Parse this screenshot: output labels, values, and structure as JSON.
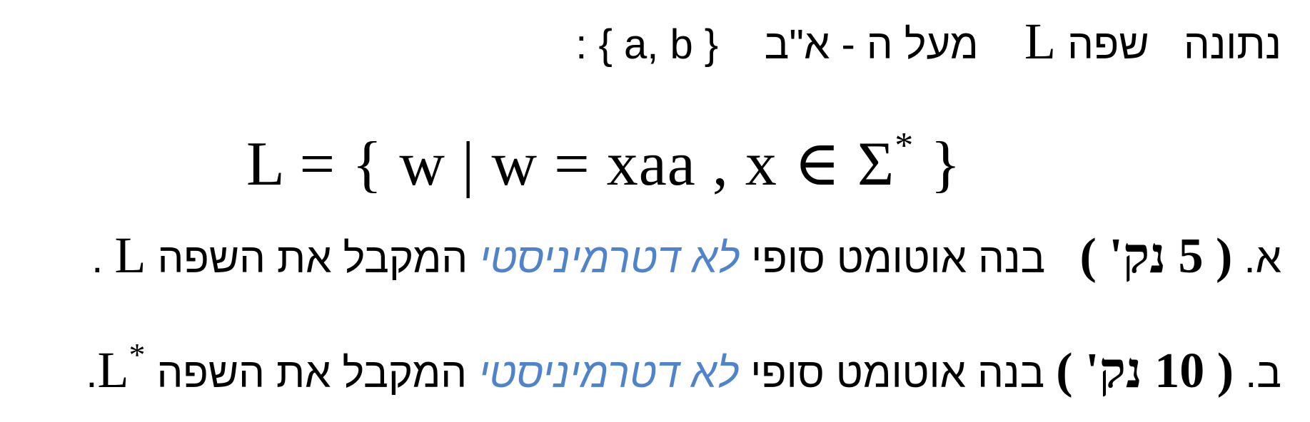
{
  "problem": {
    "intro_given": "נתונה",
    "intro_language": "שפה",
    "intro_L": "L",
    "intro_over": "מעל ה - א\"ב",
    "intro_alphabet": "{ a, b }",
    "intro_colon": ":",
    "formula": "L = { w | w = xaa , x ∈ Σ",
    "formula_star": "*",
    "formula_close": " }"
  },
  "part_a": {
    "label": "א.",
    "points": "( 5 נק' )",
    "text_before": "בנה אוטומט סופי",
    "nondeterministic": "לא דטרמיניסטי",
    "text_after": "המקבל את השפה",
    "lang": "L",
    "end": "."
  },
  "part_b": {
    "label": "ב.",
    "points": "( 10 נק' )",
    "text_before": "בנה אוטומט סופי",
    "nondeterministic": "לא דטרמיניסטי",
    "text_after": "המקבל את השפה",
    "lang": "L",
    "lang_star": "*",
    "end": "."
  }
}
